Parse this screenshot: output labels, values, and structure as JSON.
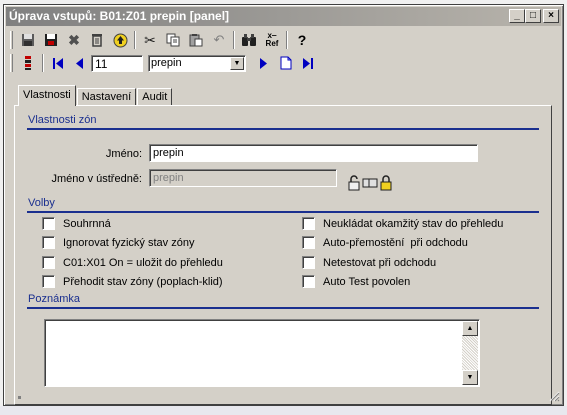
{
  "window": {
    "title": "Úprava vstupů: B01:Z01 prepin [panel]",
    "controls": {
      "minimize": "_",
      "maximize": "□",
      "close": "×"
    }
  },
  "toolbar1": {
    "icons": [
      "save-icon",
      "save-all-icon",
      "delete-x-icon",
      "trash-icon",
      "up-arrow-icon",
      "cut-icon",
      "copy-icon",
      "paste-icon",
      "undo-icon",
      "binoculars-icon",
      "xref-icon",
      "help-icon"
    ],
    "xref_label": "x-\nRef",
    "help_label": "?"
  },
  "toolbar2": {
    "number_value": "11",
    "combo_value": "prepin"
  },
  "tabs": [
    {
      "label": "Vlastnosti",
      "active": true
    },
    {
      "label": "Nastavení",
      "active": false
    },
    {
      "label": "Audit",
      "active": false
    }
  ],
  "zone_props": {
    "section_title": "Vlastnosti zón",
    "name_label": "Jméno:",
    "name_value": "prepin",
    "central_label": "Jméno v ústředně:",
    "central_value": "prepin"
  },
  "options": {
    "section_title": "Volby",
    "left": [
      {
        "label": "Souhrnná",
        "checked": false
      },
      {
        "label": "Ignorovat fyzický stav zóny",
        "checked": false
      },
      {
        "label": "C01:X01 On = uložit do přehledu",
        "checked": false
      },
      {
        "label": "Přehodit stav zóny (poplach-klid)",
        "checked": false
      }
    ],
    "right": [
      {
        "label": "Neukládat okamžitý stav do přehledu",
        "checked": false
      },
      {
        "label": "Auto-přemostění  při odchodu",
        "checked": false
      },
      {
        "label": "Netestovat při odchodu",
        "checked": false
      },
      {
        "label": "Auto Test povolen",
        "checked": false
      }
    ]
  },
  "note": {
    "section_title": "Poznámka",
    "value": ""
  },
  "colors": {
    "section_blue": "#1a2f8f",
    "window_face": "#d4d0c8",
    "nav_blue": "#0000c0"
  }
}
